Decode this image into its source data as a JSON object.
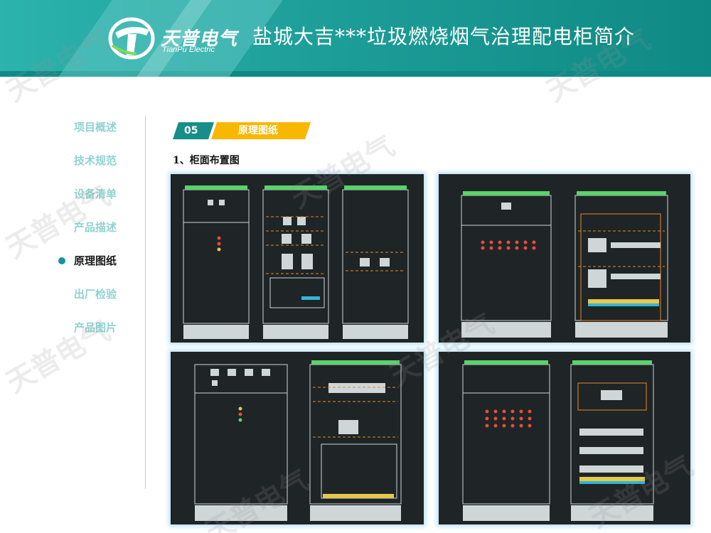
{
  "header": {
    "logo_cn": "天普电气",
    "logo_en": "TianPu Electric",
    "title": "盐城大吉***垃圾燃烧烟气治理配电柜简介"
  },
  "sidebar": {
    "items": [
      {
        "label": "项目概述",
        "active": false
      },
      {
        "label": "技术规范",
        "active": false
      },
      {
        "label": "设备清单",
        "active": false
      },
      {
        "label": "产品描述",
        "active": false
      },
      {
        "label": "原理图纸",
        "active": true
      },
      {
        "label": "出厂检验",
        "active": false
      },
      {
        "label": "产品图片",
        "active": false
      }
    ]
  },
  "section": {
    "number": "05",
    "label": "原理图纸",
    "subheading": "1、柜面布置图"
  },
  "watermark": "天普电气",
  "colors": {
    "teal": "#1e9e99",
    "teal_light": "#8fd3cf",
    "yellow": "#f8b700",
    "drawing_bg": "#1f2426"
  }
}
